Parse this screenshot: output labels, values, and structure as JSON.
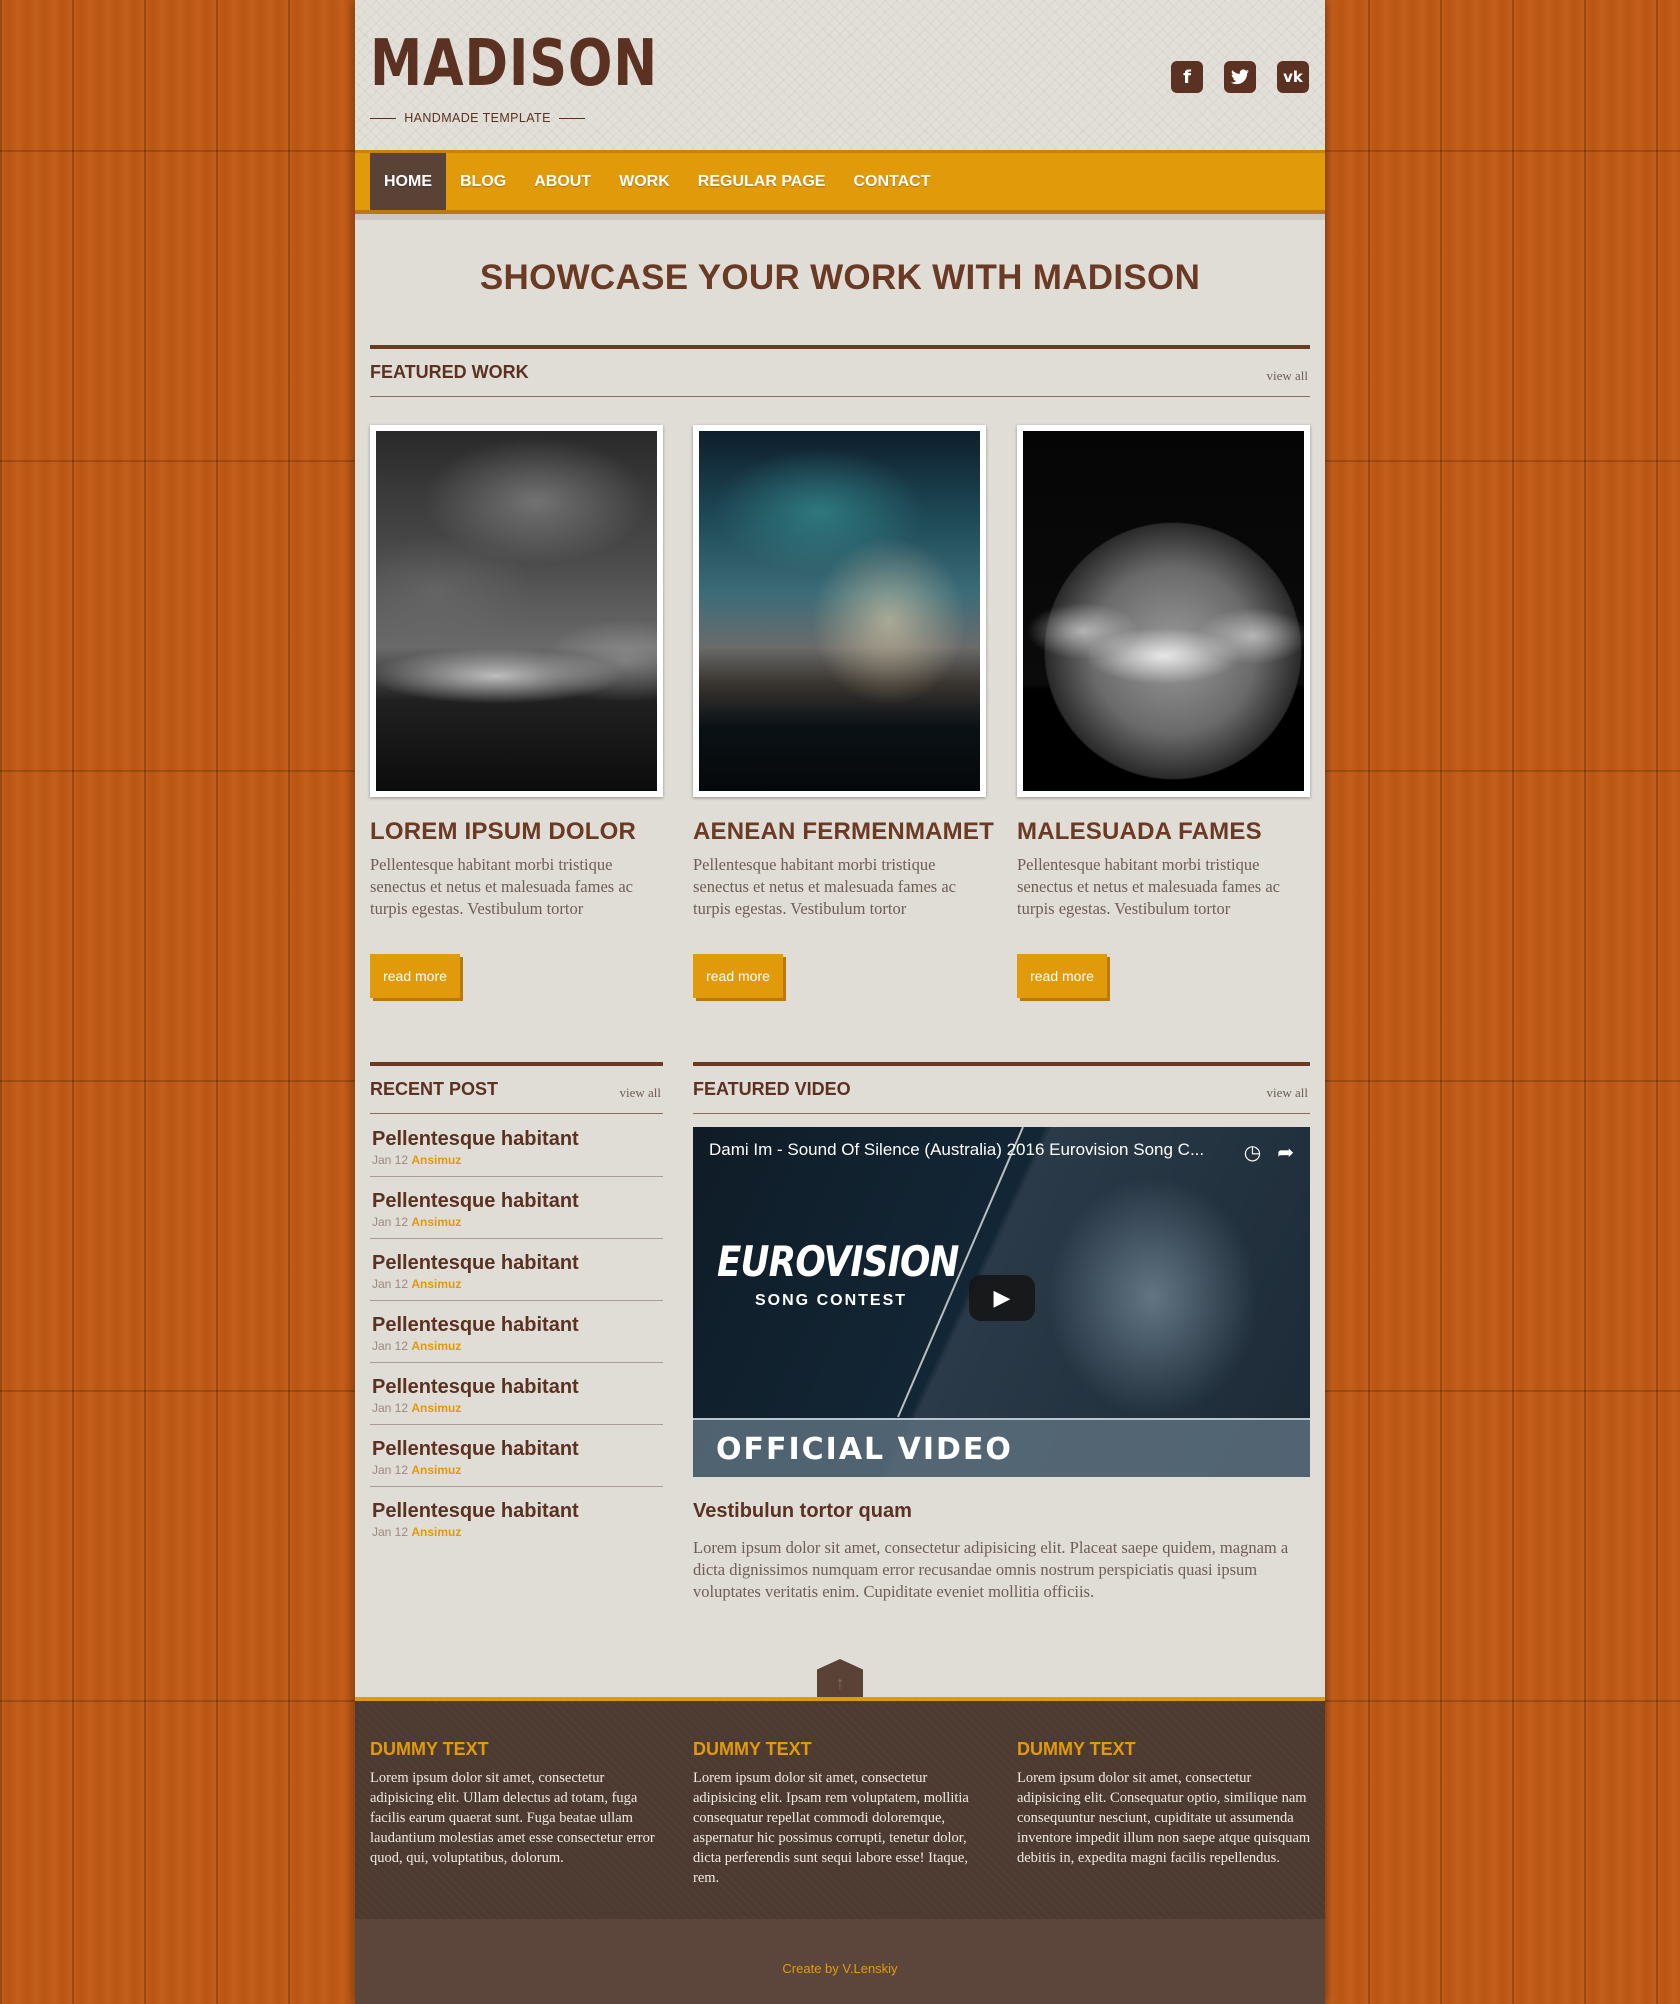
{
  "brand": {
    "logo": "MADISON",
    "tagline": "HANDMADE TEMPLATE"
  },
  "social": [
    {
      "icon": "facebook-icon",
      "glyph": "f"
    },
    {
      "icon": "twitter-icon",
      "glyph": "t"
    },
    {
      "icon": "vk-icon",
      "glyph": "vk"
    }
  ],
  "nav": {
    "items": [
      "HOME",
      "BLOG",
      "ABOUT",
      "WORK",
      "REGULAR PAGE",
      "CONTACT"
    ],
    "active": "HOME"
  },
  "hero": {
    "title": "SHOWCASE YOUR WORK WITH MADISON"
  },
  "featured_work": {
    "title": "FEATURED WORK",
    "view_all": "view all",
    "items": [
      {
        "title": "LOREM IPSUM DOLOR",
        "text": "Pellentesque habitant morbi tristique senectus et netus et malesuada fames ac turpis egestas. Vestibulum tortor",
        "button": "read more"
      },
      {
        "title": "AENEAN FERMENMAMET",
        "text": "Pellentesque habitant morbi tristique senectus et netus et malesuada fames ac turpis egestas. Vestibulum tortor",
        "button": "read more"
      },
      {
        "title": "MALESUADA FAMES",
        "text": "Pellentesque habitant morbi tristique senectus et netus et malesuada fames ac turpis egestas. Vestibulum tortor",
        "button": "read more"
      }
    ]
  },
  "recent_post": {
    "title": "RECENT POST",
    "view_all": "view all",
    "items": [
      {
        "title": "Pellentesque habitant",
        "date": "Jan 12",
        "author": "Ansimuz"
      },
      {
        "title": "Pellentesque habitant",
        "date": "Jan 12",
        "author": "Ansimuz"
      },
      {
        "title": "Pellentesque habitant",
        "date": "Jan 12",
        "author": "Ansimuz"
      },
      {
        "title": "Pellentesque habitant",
        "date": "Jan 12",
        "author": "Ansimuz"
      },
      {
        "title": "Pellentesque habitant",
        "date": "Jan 12",
        "author": "Ansimuz"
      },
      {
        "title": "Pellentesque habitant",
        "date": "Jan 12",
        "author": "Ansimuz"
      },
      {
        "title": "Pellentesque habitant",
        "date": "Jan 12",
        "author": "Ansimuz"
      }
    ]
  },
  "featured_video": {
    "title": "FEATURED VIDEO",
    "view_all": "view all",
    "video_title": "Dami Im - Sound Of Silence (Australia) 2016 Eurovision Song C...",
    "logo_line1": "EUROVISION",
    "logo_line2": "SONG CONTEST",
    "banner": "OFFICIAL VIDEO",
    "heading": "Vestibulun tortor quam",
    "text": "Lorem ipsum dolor sit amet, consectetur adipisicing elit. Placeat saepe quidem, magnam a dicta dignissimos numquam error recusandae omnis nostrum perspiciatis quasi ipsum voluptates veritatis enim. Cupiditate eveniet mollitia officiis."
  },
  "footer": {
    "columns": [
      {
        "title": "DUMMY TEXT",
        "text": "Lorem ipsum dolor sit amet, consectetur adipisicing elit. Ullam delectus ad totam, fuga facilis earum quaerat sunt. Fuga beatae ullam laudantium molestias amet esse consectetur error quod, qui, voluptatibus, dolorum."
      },
      {
        "title": "DUMMY TEXT",
        "text": "Lorem ipsum dolor sit amet, consectetur adipisicing elit. Ipsam rem voluptatem, mollitia consequatur repellat commodi doloremque, aspernatur hic possimus corrupti, tenetur dolor, dicta perferendis sunt sequi labore esse! Itaque, rem."
      },
      {
        "title": "DUMMY TEXT",
        "text": "Lorem ipsum dolor sit amet, consectetur adipisicing elit. Consequatur optio, similique nam consequuntur nesciunt, cupiditate ut assumenda inventore impedit illum non saepe atque quisquam debitis in, expedita magni facilis repellendus."
      }
    ],
    "copyright": "Create by V.Lenskiy"
  },
  "colors": {
    "accent": "#e19a0a",
    "brown": "#5b3221",
    "wood": "#c25a14",
    "paper": "#e0dcd6"
  }
}
